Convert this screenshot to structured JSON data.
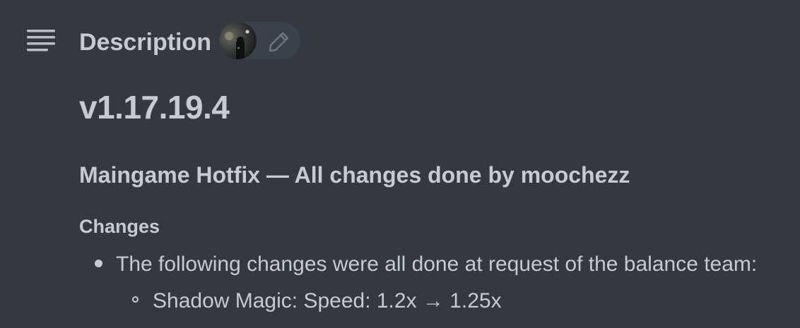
{
  "header": {
    "icon": "description-lines-icon",
    "title": "Description",
    "avatar": "user-avatar",
    "edit_icon": "pencil-icon"
  },
  "content": {
    "version": "v1.17.19.4",
    "subtitle": "Maingame Hotfix — All changes done by moochezz",
    "section_heading": "Changes",
    "bullets": [
      {
        "text": "The following changes were all done at request of the balance team:",
        "sub_items": [
          {
            "text": "Shadow Magic: Speed: 1.2x → 1.25x"
          }
        ]
      }
    ]
  },
  "colors": {
    "background": "#333841",
    "text": "#c5cad3",
    "pill": "#3b414b"
  }
}
